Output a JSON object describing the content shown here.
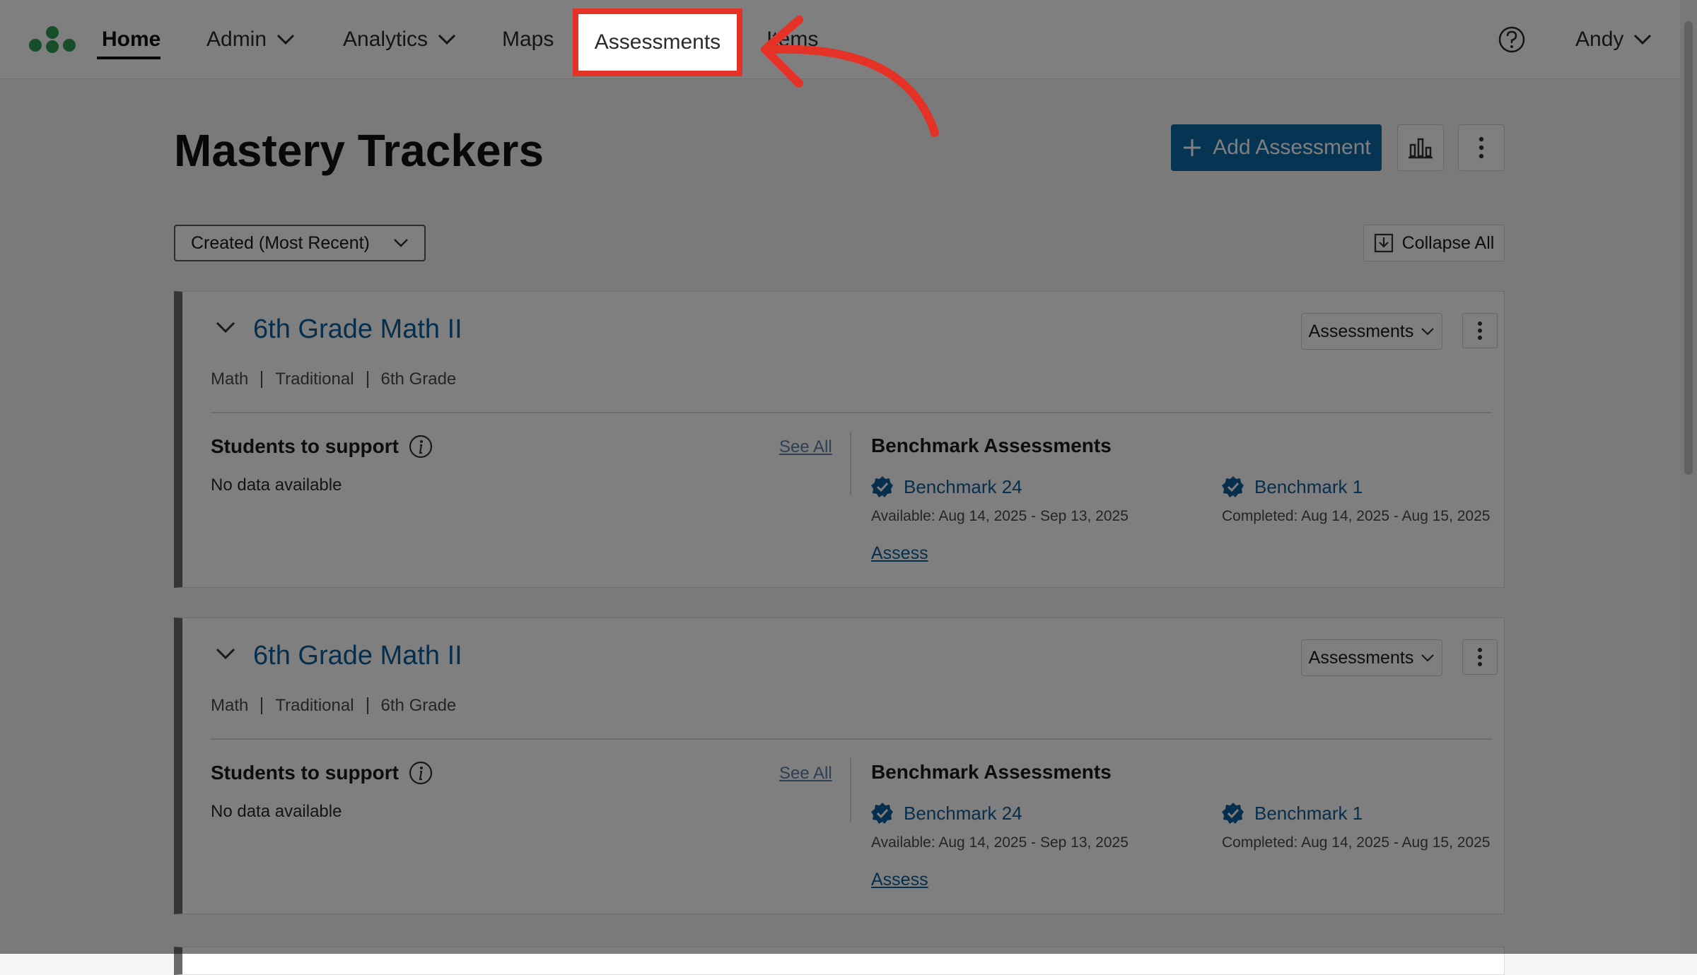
{
  "nav": {
    "home": "Home",
    "admin": "Admin",
    "analytics": "Analytics",
    "maps": "Maps",
    "assessments": "Assessments",
    "items": "Items",
    "user": "Andy"
  },
  "page": {
    "title": "Mastery Trackers",
    "add_button": "Add Assessment",
    "sort_select": "Created (Most Recent)",
    "collapse_all": "Collapse All"
  },
  "cards": [
    {
      "title": "6th Grade Math II",
      "meta": [
        "Math",
        "Traditional",
        "6th Grade"
      ],
      "view_select": "Assessments",
      "students_heading": "Students to support",
      "see_all": "See All",
      "no_data": "No data available",
      "benchmark_heading": "Benchmark Assessments",
      "benchmarks": [
        {
          "name": "Benchmark 24",
          "dates": "Available: Aug 14, 2025 - Sep 13, 2025"
        },
        {
          "name": "Benchmark 1",
          "dates": "Completed: Aug 14, 2025 - Aug 15, 2025"
        }
      ],
      "assess_link": "Assess"
    },
    {
      "title": "6th Grade Math II",
      "meta": [
        "Math",
        "Traditional",
        "6th Grade"
      ],
      "view_select": "Assessments",
      "students_heading": "Students to support",
      "see_all": "See All",
      "no_data": "No data available",
      "benchmark_heading": "Benchmark Assessments",
      "benchmarks": [
        {
          "name": "Benchmark 24",
          "dates": "Available: Aug 14, 2025 - Sep 13, 2025"
        },
        {
          "name": "Benchmark 1",
          "dates": "Completed: Aug 14, 2025 - Aug 15, 2025"
        }
      ],
      "assess_link": "Assess"
    }
  ],
  "colors": {
    "primary": "#0b6aa6",
    "link": "#0b5f99",
    "highlight": "#e53227",
    "logo": "#2e9b4e"
  },
  "icons": [
    "logo-icon",
    "chevron-down-icon",
    "help-icon",
    "plus-icon",
    "bar-chart-icon",
    "kebab-icon",
    "collapse-icon",
    "info-icon",
    "verified-badge-icon",
    "arrow-icon"
  ]
}
